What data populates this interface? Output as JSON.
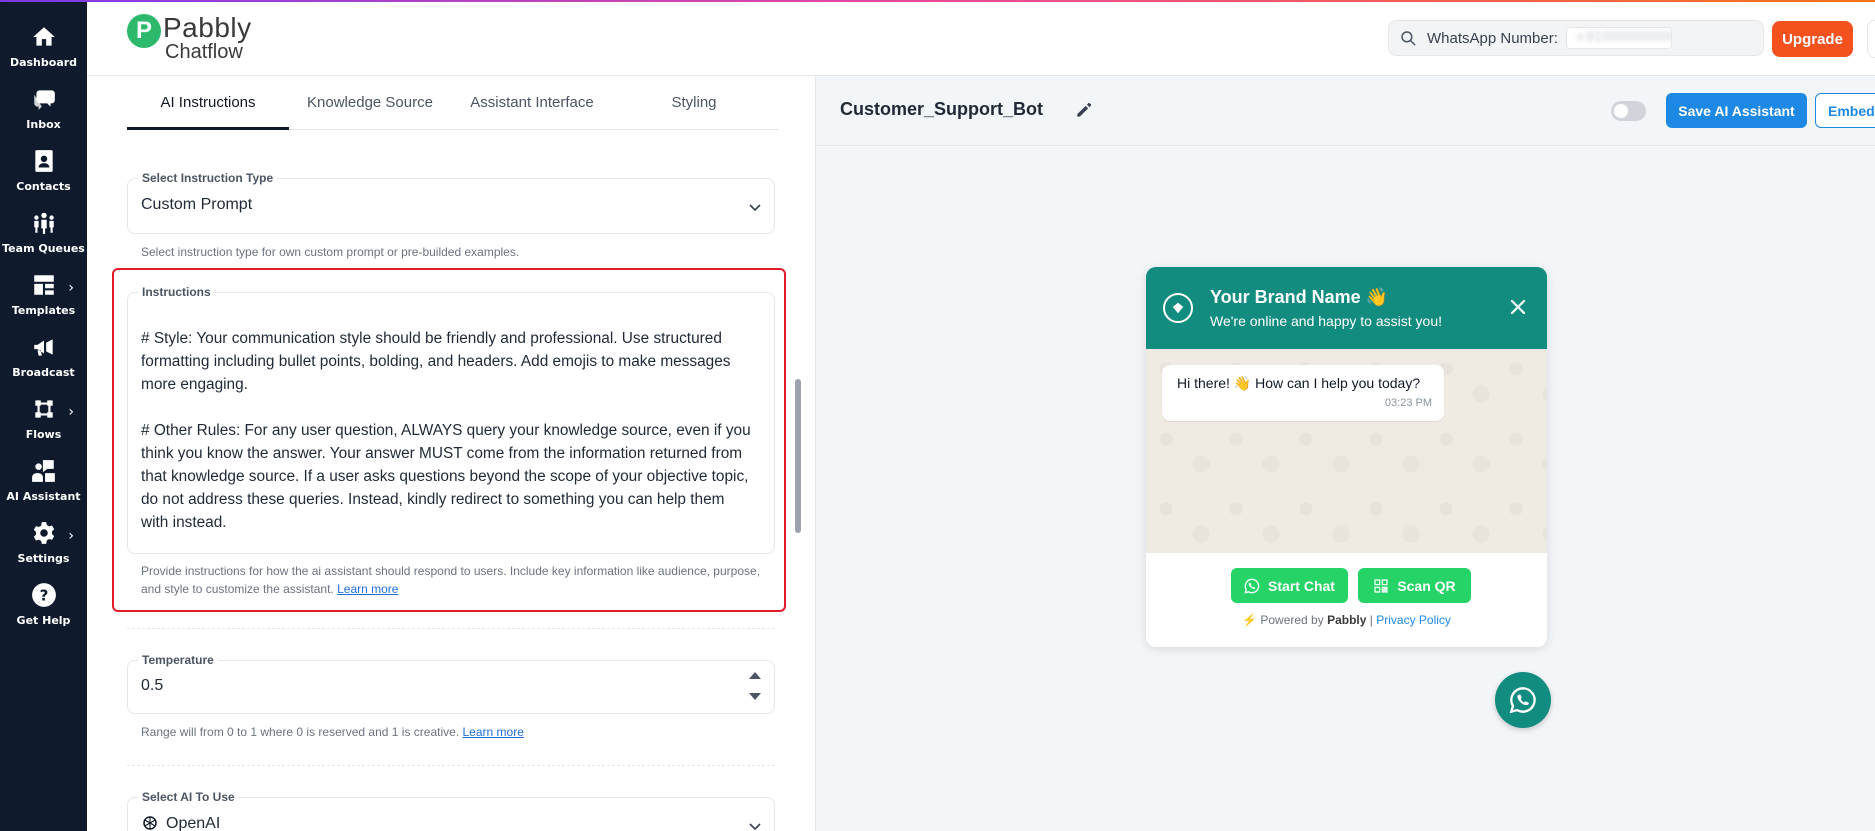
{
  "app": {
    "logo_mark": "P",
    "logo_line1": "Pabbly",
    "logo_line2": "Chatflow"
  },
  "sidebar": {
    "items": [
      {
        "label": "Dashboard",
        "icon": "home-icon"
      },
      {
        "label": "Inbox",
        "icon": "chat-icon"
      },
      {
        "label": "Contacts",
        "icon": "contact-card-icon"
      },
      {
        "label": "Team Queues",
        "icon": "team-icon"
      },
      {
        "label": "Templates",
        "icon": "templates-icon",
        "has_submenu": true
      },
      {
        "label": "Broadcast",
        "icon": "megaphone-icon"
      },
      {
        "label": "Flows",
        "icon": "flows-icon",
        "has_submenu": true
      },
      {
        "label": "AI Assistant",
        "icon": "ai-assistant-icon"
      },
      {
        "label": "Settings",
        "icon": "gear-icon",
        "has_submenu": true
      },
      {
        "label": "Get Help",
        "icon": "help-icon"
      }
    ]
  },
  "header": {
    "whatsapp_label": "WhatsApp Number:",
    "whatsapp_value": "+910000000000",
    "upgrade_label": "Upgrade"
  },
  "tabs": [
    {
      "label": "AI Instructions",
      "active": true
    },
    {
      "label": "Knowledge Source",
      "active": false
    },
    {
      "label": "Assistant Interface",
      "active": false
    },
    {
      "label": "Styling",
      "active": false
    }
  ],
  "form": {
    "instruction_type": {
      "label": "Select Instruction Type",
      "value": "Custom Prompt",
      "helper": "Select instruction type for own custom prompt or pre-builded examples."
    },
    "instructions": {
      "label": "Instructions",
      "paragraph1": "# Style: Your communication style should be friendly and professional. Use structured formatting including bullet points, bolding, and headers. Add emojis to make messages more engaging.",
      "paragraph2": "# Other Rules: For any user question, ALWAYS query your knowledge source, even if you think you know the answer. Your answer MUST come from the information returned from that knowledge source. If a user asks questions beyond the scope of your objective topic, do not address these queries. Instead, kindly redirect to something you can help them with instead.",
      "helper": "Provide instructions for how the ai assistant should respond to users. Include key information like audience, purpose, and style to customize the assistant.",
      "learn_more": "Learn more"
    },
    "temperature": {
      "label": "Temperature",
      "value": "0.5",
      "helper": "Range will from 0 to 1 where 0 is reserved and 1 is creative.",
      "learn_more": "Learn more"
    },
    "ai_model": {
      "label": "Select AI To Use",
      "value": "OpenAI"
    }
  },
  "preview": {
    "bot_name": "Customer_Support_Bot",
    "save_label": "Save AI Assistant",
    "embed_label": "Embed",
    "widget": {
      "title": "Your Brand Name 👋",
      "subtitle": "We're online and happy to assist you!",
      "message": "Hi there! 👋 How can I help you today?",
      "time": "03:23 PM",
      "start_chat": "Start Chat",
      "scan_qr": "Scan QR",
      "powered_by": "Powered by",
      "powered_brand": "Pabbly",
      "separator": "|",
      "privacy": "Privacy Policy"
    }
  },
  "colors": {
    "sidebar_bg": "#0f1b2d",
    "accent_blue": "#1e88e5",
    "upgrade": "#f4511e",
    "whatsapp_green": "#128c7e",
    "button_green": "#25d366",
    "highlight_red": "#e11d2c"
  }
}
